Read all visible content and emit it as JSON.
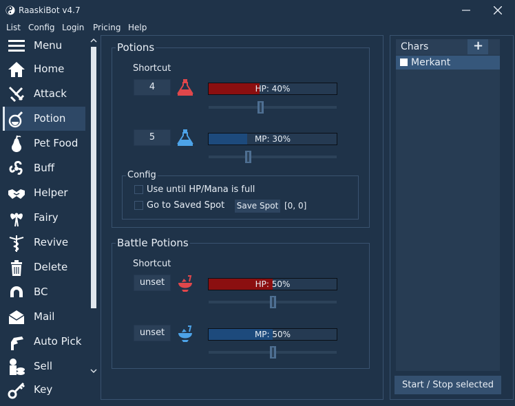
{
  "window": {
    "title": "RaaskiBot v4.7"
  },
  "menubar": [
    "List",
    "Config",
    "Login",
    "Pricing",
    "Help"
  ],
  "nav": {
    "active": "Potion",
    "items": [
      "Menu",
      "Home",
      "Attack",
      "Potion",
      "Pet Food",
      "Buff",
      "Helper",
      "Fairy",
      "Revive",
      "Delete",
      "BC",
      "Mail",
      "Auto Pick",
      "Sell",
      "Key"
    ]
  },
  "potions": {
    "title": "Potions",
    "shortcut_label": "Shortcut",
    "hp": {
      "shortcut": "4",
      "bar_text": "HP: 40%",
      "value": 0.4,
      "slider": 0.4
    },
    "mp": {
      "shortcut": "5",
      "bar_text": "MP: 30%",
      "value": 0.3,
      "slider": 0.3
    },
    "config": {
      "title": "Config",
      "use_until_full": {
        "label": "Use until HP/Mana is full",
        "checked": false
      },
      "go_to_saved_spot": {
        "label": "Go to Saved Spot",
        "checked": false
      },
      "save_spot_button": "Save Spot",
      "saved_coords": "[0, 0]"
    }
  },
  "battle_potions": {
    "title": "Battle Potions",
    "shortcut_label": "Shortcut",
    "hp": {
      "shortcut": "unset",
      "bar_text": "HP: 50%",
      "value": 0.5,
      "slider": 0.5
    },
    "mp": {
      "shortcut": "unset",
      "bar_text": "MP: 50%",
      "value": 0.5,
      "slider": 0.5
    }
  },
  "chars": {
    "header": "Chars",
    "add_label": "+",
    "items": [
      {
        "name": "Merkant",
        "checked": false
      }
    ],
    "start_stop_button": "Start / Stop selected"
  },
  "colors": {
    "background": "#1f3349",
    "hp_fill": "#8b0f10",
    "mp_fill": "#1d4a7c",
    "selected_row": "#36577b",
    "hp_icon": "#e0474b",
    "mp_icon": "#4da3e8"
  }
}
